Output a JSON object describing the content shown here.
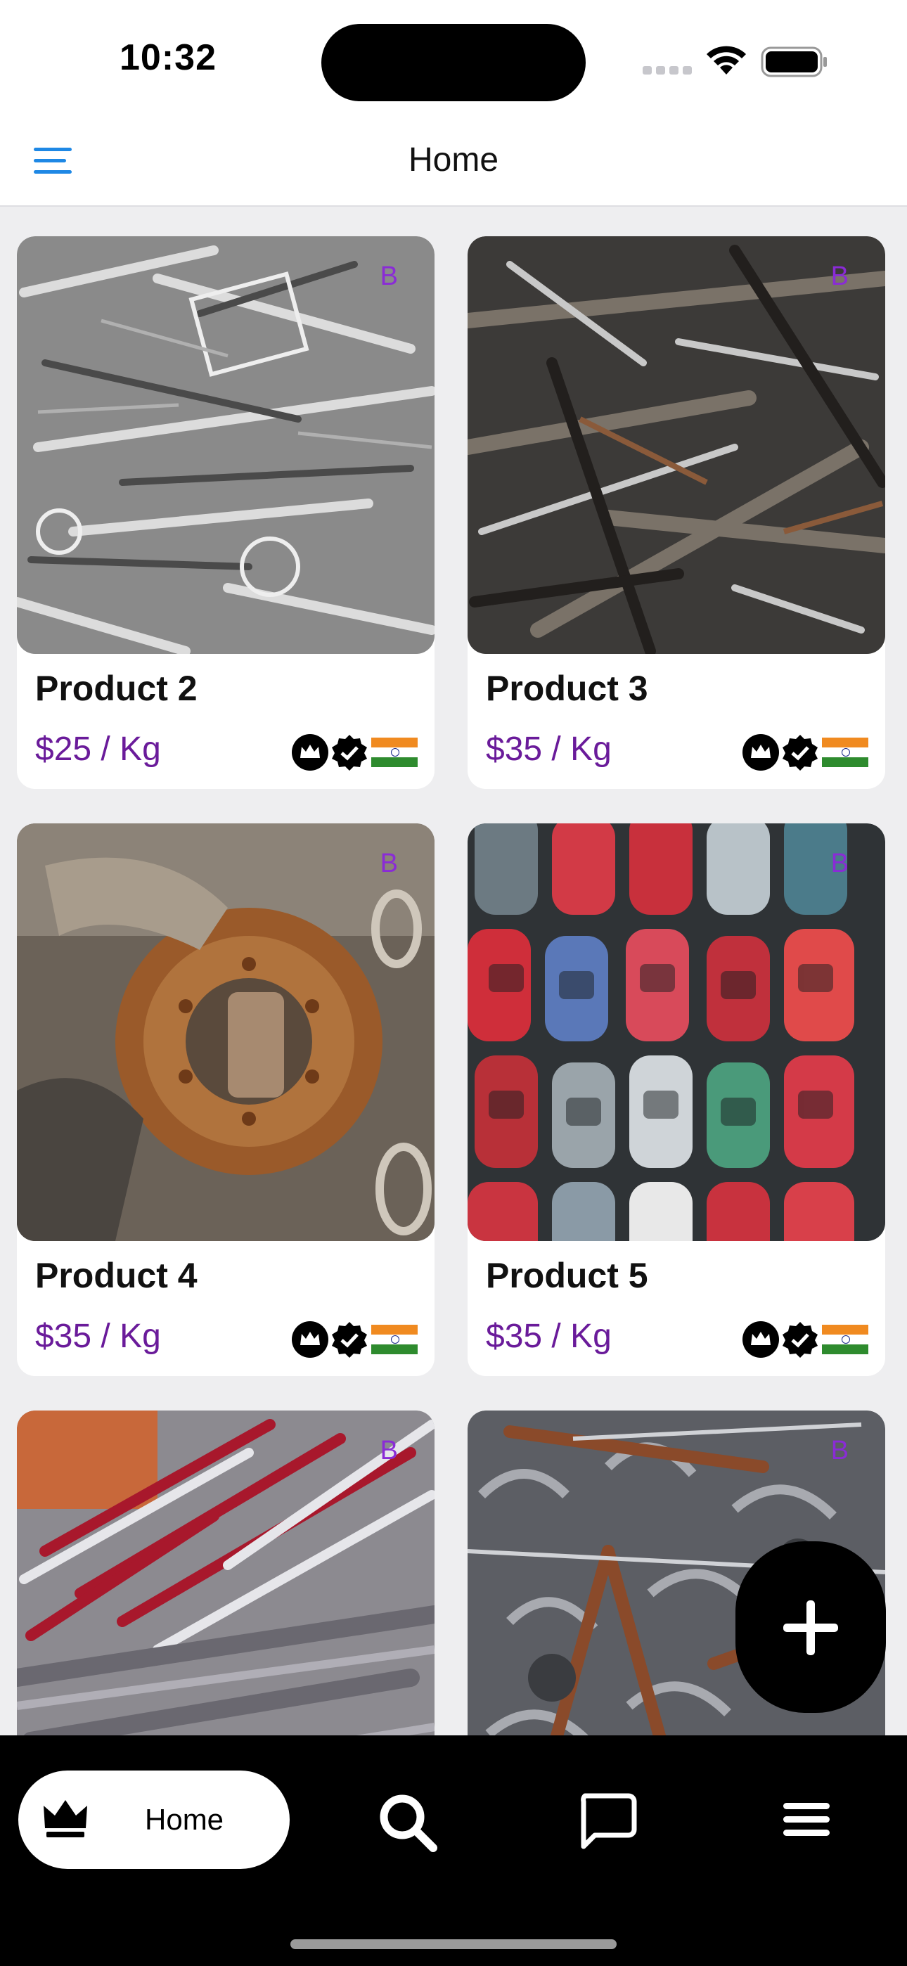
{
  "status_bar": {
    "time": "10:32"
  },
  "nav": {
    "title": "Home",
    "menu_icon": "hamburger-icon"
  },
  "products": [
    {
      "name": "Product 2",
      "price": "$25 / Kg",
      "badge": "B",
      "photo": "silver-scrap-pile",
      "icons": [
        "crown-badge-icon",
        "verified-check-icon",
        "india-flag-icon"
      ]
    },
    {
      "name": "Product 3",
      "price": "$35 / Kg",
      "badge": "B",
      "photo": "steel-bars-scrap",
      "icons": [
        "crown-badge-icon",
        "verified-check-icon",
        "india-flag-icon"
      ]
    },
    {
      "name": "Product 4",
      "price": "$35 / Kg",
      "badge": "B",
      "photo": "rusty-gear-scrap",
      "icons": [
        "crown-badge-icon",
        "verified-check-icon",
        "india-flag-icon"
      ]
    },
    {
      "name": "Product 5",
      "price": "$35 / Kg",
      "badge": "B",
      "photo": "scrapped-cars",
      "icons": [
        "crown-badge-icon",
        "verified-check-icon",
        "india-flag-icon"
      ]
    },
    {
      "name": "",
      "price": "",
      "badge": "B",
      "photo": "aluminium-profiles-scrap",
      "icons": []
    },
    {
      "name": "",
      "price": "",
      "badge": "B",
      "photo": "cut-steel-pieces",
      "icons": []
    }
  ],
  "fab": {
    "icon": "plus-icon"
  },
  "tab_bar": {
    "items": [
      {
        "label": "Home",
        "icon": "crown-icon",
        "active": true
      },
      {
        "label": "",
        "icon": "search-icon",
        "active": false
      },
      {
        "label": "",
        "icon": "chat-icon",
        "active": false
      },
      {
        "label": "",
        "icon": "menu-icon",
        "active": false
      }
    ]
  },
  "colors": {
    "accent": "#1e88e5",
    "price": "#6a1b9a",
    "badge": "#8a2bd6",
    "tab_bar": "#000000"
  }
}
